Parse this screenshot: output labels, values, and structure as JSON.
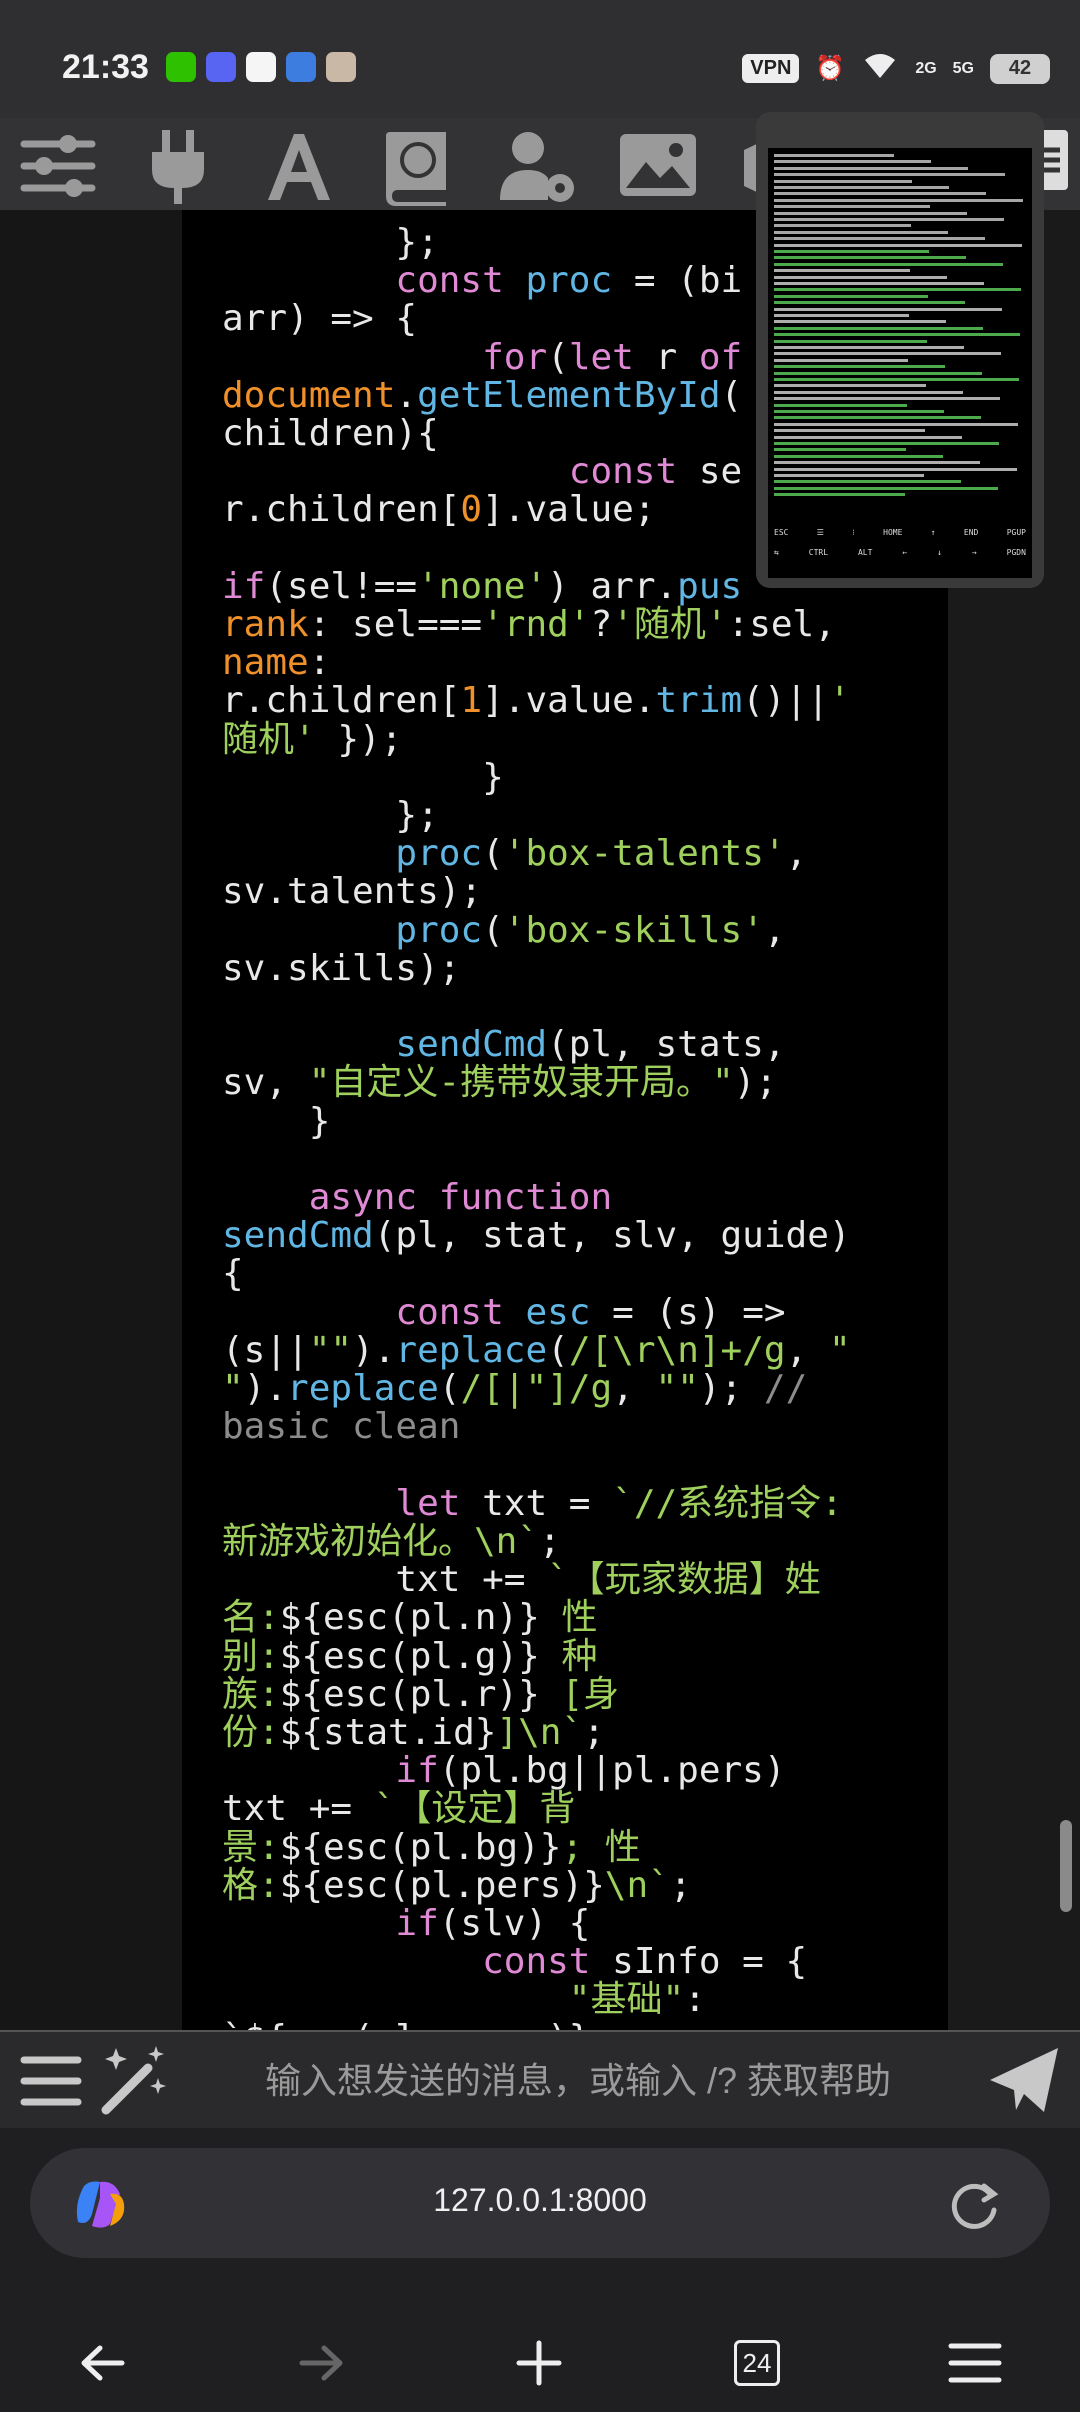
{
  "status": {
    "time": "21:33",
    "vpn": "VPN",
    "battery": "42",
    "net1": "2G",
    "net2": "5G"
  },
  "code": {
    "lines": [
      [
        {
          "t": "        };"
        }
      ],
      [
        {
          "t": "        "
        },
        {
          "t": "const",
          "c": "k"
        },
        {
          "t": " "
        },
        {
          "t": "proc",
          "c": "f"
        },
        {
          "t": " = (bi"
        }
      ],
      [
        {
          "t": "arr) => {"
        }
      ],
      [
        {
          "t": "            "
        },
        {
          "t": "for",
          "c": "k"
        },
        {
          "t": "("
        },
        {
          "t": "let",
          "c": "k"
        },
        {
          "t": " r "
        },
        {
          "t": "of",
          "c": "k"
        }
      ],
      [
        {
          "t": "document",
          "c": "o"
        },
        {
          "t": "."
        },
        {
          "t": "getElementById",
          "c": "f"
        },
        {
          "t": "("
        }
      ],
      [
        {
          "t": "children){"
        }
      ],
      [
        {
          "t": "                "
        },
        {
          "t": "const",
          "c": "k"
        },
        {
          "t": " se"
        }
      ],
      [
        {
          "t": "r.children["
        },
        {
          "t": "0",
          "c": "o"
        },
        {
          "t": "].value;"
        }
      ],
      [
        {
          "t": ""
        }
      ],
      [
        {
          "t": "if",
          "c": "k"
        },
        {
          "t": "(sel!=="
        },
        {
          "t": "'none'",
          "c": "s"
        },
        {
          "t": ") arr."
        },
        {
          "t": "pus",
          "c": "f"
        }
      ],
      [
        {
          "t": "rank",
          "c": "o"
        },
        {
          "t": ": sel==="
        },
        {
          "t": "'rnd'",
          "c": "s"
        },
        {
          "t": "?"
        },
        {
          "t": "'随机'",
          "c": "s"
        },
        {
          "t": ":sel,"
        }
      ],
      [
        {
          "t": "name",
          "c": "o"
        },
        {
          "t": ":"
        }
      ],
      [
        {
          "t": "r.children["
        },
        {
          "t": "1",
          "c": "o"
        },
        {
          "t": "].value."
        },
        {
          "t": "trim",
          "c": "f"
        },
        {
          "t": "()||"
        },
        {
          "t": "'",
          "c": "s"
        }
      ],
      [
        {
          "t": "随机'",
          "c": "s"
        },
        {
          "t": " });"
        }
      ],
      [
        {
          "t": "            }"
        }
      ],
      [
        {
          "t": "        };"
        }
      ],
      [
        {
          "t": "        "
        },
        {
          "t": "proc",
          "c": "f"
        },
        {
          "t": "("
        },
        {
          "t": "'box-talents'",
          "c": "s"
        },
        {
          "t": ","
        }
      ],
      [
        {
          "t": "sv.talents);"
        }
      ],
      [
        {
          "t": "        "
        },
        {
          "t": "proc",
          "c": "f"
        },
        {
          "t": "("
        },
        {
          "t": "'box-skills'",
          "c": "s"
        },
        {
          "t": ","
        }
      ],
      [
        {
          "t": "sv.skills);"
        }
      ],
      [
        {
          "t": ""
        }
      ],
      [
        {
          "t": "        "
        },
        {
          "t": "sendCmd",
          "c": "f"
        },
        {
          "t": "(pl, stats,"
        }
      ],
      [
        {
          "t": "sv, "
        },
        {
          "t": "\"自定义-携带奴隶开局。\"",
          "c": "s"
        },
        {
          "t": ");"
        }
      ],
      [
        {
          "t": "    }"
        }
      ],
      [
        {
          "t": ""
        }
      ],
      [
        {
          "t": "    "
        },
        {
          "t": "async",
          "c": "k"
        },
        {
          "t": " "
        },
        {
          "t": "function",
          "c": "k"
        }
      ],
      [
        {
          "t": "sendCmd",
          "c": "f"
        },
        {
          "t": "(pl, stat, slv, guide)"
        }
      ],
      [
        {
          "t": "{"
        }
      ],
      [
        {
          "t": "        "
        },
        {
          "t": "const",
          "c": "k"
        },
        {
          "t": " "
        },
        {
          "t": "esc",
          "c": "f"
        },
        {
          "t": " = (s) =>"
        }
      ],
      [
        {
          "t": "(s||"
        },
        {
          "t": "\"\"",
          "c": "s"
        },
        {
          "t": ")."
        },
        {
          "t": "replace",
          "c": "f"
        },
        {
          "t": "("
        },
        {
          "t": "/[\\r\\n]+/g",
          "c": "s"
        },
        {
          "t": ", "
        },
        {
          "t": "\"",
          "c": "s"
        }
      ],
      [
        {
          "t": "\"",
          "c": "s"
        },
        {
          "t": ")."
        },
        {
          "t": "replace",
          "c": "f"
        },
        {
          "t": "("
        },
        {
          "t": "/[|\"]/g",
          "c": "s"
        },
        {
          "t": ", "
        },
        {
          "t": "\"\"",
          "c": "s"
        },
        {
          "t": "); "
        },
        {
          "t": "//",
          "c": "c"
        }
      ],
      [
        {
          "t": "basic clean",
          "c": "c"
        }
      ],
      [
        {
          "t": ""
        }
      ],
      [
        {
          "t": "        "
        },
        {
          "t": "let",
          "c": "k"
        },
        {
          "t": " txt = "
        },
        {
          "t": "`//系统指令:",
          "c": "s"
        }
      ],
      [
        {
          "t": "新游戏初始化。\\n`",
          "c": "s"
        },
        {
          "t": ";"
        }
      ],
      [
        {
          "t": "        txt += "
        },
        {
          "t": "`【玩家数据】姓",
          "c": "s"
        }
      ],
      [
        {
          "t": "名:",
          "c": "s"
        },
        {
          "t": "${esc(pl.n)}"
        },
        {
          "t": " 性",
          "c": "s"
        }
      ],
      [
        {
          "t": "别:",
          "c": "s"
        },
        {
          "t": "${esc(pl.g)}"
        },
        {
          "t": " 种",
          "c": "s"
        }
      ],
      [
        {
          "t": "族:",
          "c": "s"
        },
        {
          "t": "${esc(pl.r)}"
        },
        {
          "t": " [身",
          "c": "s"
        }
      ],
      [
        {
          "t": "份:",
          "c": "s"
        },
        {
          "t": "${stat.id}"
        },
        {
          "t": "]\\n`",
          "c": "s"
        },
        {
          "t": ";"
        }
      ],
      [
        {
          "t": "        "
        },
        {
          "t": "if",
          "c": "k"
        },
        {
          "t": "(pl.bg||pl.pers)"
        }
      ],
      [
        {
          "t": "txt += "
        },
        {
          "t": "`【设定】背",
          "c": "s"
        }
      ],
      [
        {
          "t": "景:",
          "c": "s"
        },
        {
          "t": "${esc(pl.bg)}"
        },
        {
          "t": "; 性",
          "c": "s"
        }
      ],
      [
        {
          "t": "格:",
          "c": "s"
        },
        {
          "t": "${esc(pl.pers)}"
        },
        {
          "t": "\\n`",
          "c": "s"
        },
        {
          "t": ";"
        }
      ],
      [
        {
          "t": "        "
        },
        {
          "t": "if",
          "c": "k"
        },
        {
          "t": "(slv) {"
        }
      ],
      [
        {
          "t": "            "
        },
        {
          "t": "const",
          "c": "k"
        },
        {
          "t": " sInfo = {"
        }
      ],
      [
        {
          "t": "                "
        },
        {
          "t": "\"基础\"",
          "c": "s"
        },
        {
          "t": ":"
        }
      ],
      [
        {
          "t": "`${esc(slv.name)}"
        }
      ]
    ]
  },
  "terminal": {
    "keys_row1": [
      "ESC",
      "☰",
      "⁝",
      "HOME",
      "↑",
      "END",
      "PGUP"
    ],
    "keys_row2": [
      "⇆",
      "CTRL",
      "ALT",
      "←",
      "↓",
      "→",
      "PGDN"
    ]
  },
  "chat": {
    "placeholder": "输入想发送的消息，或输入 /? 获取帮助"
  },
  "browser": {
    "url": "127.0.0.1:8000",
    "tab_count": "24"
  }
}
